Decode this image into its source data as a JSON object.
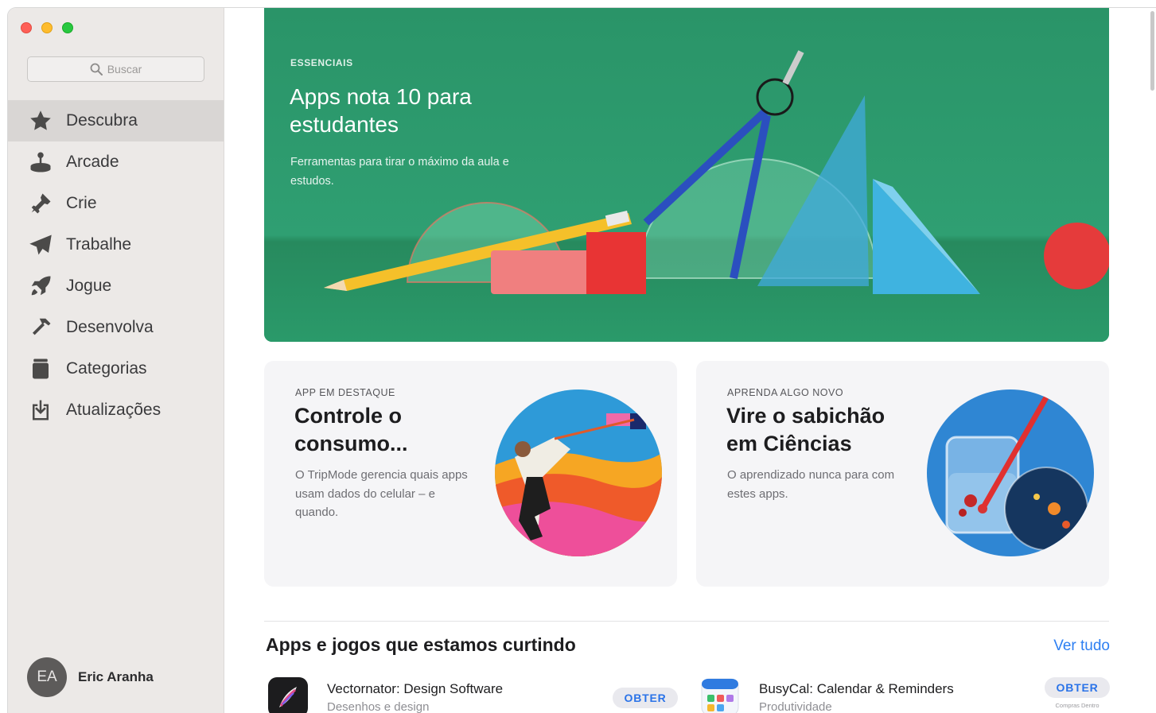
{
  "window": {
    "buttons": [
      "close",
      "minimize",
      "maximize"
    ]
  },
  "sidebar": {
    "search": {
      "placeholder": "Buscar"
    },
    "items": [
      {
        "label": "Descubra",
        "icon": "star-icon",
        "active": true
      },
      {
        "label": "Arcade",
        "icon": "joystick-icon"
      },
      {
        "label": "Crie",
        "icon": "brush-icon"
      },
      {
        "label": "Trabalhe",
        "icon": "paper-plane-icon"
      },
      {
        "label": "Jogue",
        "icon": "rocket-icon"
      },
      {
        "label": "Desenvolva",
        "icon": "hammer-icon"
      },
      {
        "label": "Categorias",
        "icon": "archive-icon"
      },
      {
        "label": "Atualizações",
        "icon": "download-icon"
      }
    ],
    "profile": {
      "initials": "EA",
      "name": "Eric Aranha"
    }
  },
  "hero": {
    "eyebrow": "ESSENCIAIS",
    "title": "Apps nota 10 para estudantes",
    "subtitle": "Ferramentas para tirar o máximo da aula e estudos.",
    "color": "#2c9a6c"
  },
  "cards": [
    {
      "eyebrow": "APP EM DESTAQUE",
      "title": "Controle o consumo...",
      "description": "O TripMode gerencia quais apps usam dados do celular – e quando."
    },
    {
      "eyebrow": "APRENDA ALGO NOVO",
      "title": "Vire o sabichão em Ciências",
      "description": "O aprendizado nunca para com estes apps."
    }
  ],
  "section": {
    "title": "Apps e jogos que estamos curtindo",
    "see_all": "Ver tudo"
  },
  "apps": [
    {
      "name": "Vectornator: Design Software",
      "category": "Desenhos e design",
      "button": "OBTER",
      "icon": "vectornator-icon"
    },
    {
      "name": "BusyCal: Calendar & Reminders",
      "category": "Produtividade",
      "button": "OBTER",
      "note": "Compras Dentro",
      "icon": "busycal-icon"
    }
  ],
  "colors": {
    "accent": "#2d7ff2",
    "sidebar_bg": "#ece9e7",
    "active_item": "#d9d6d4"
  }
}
